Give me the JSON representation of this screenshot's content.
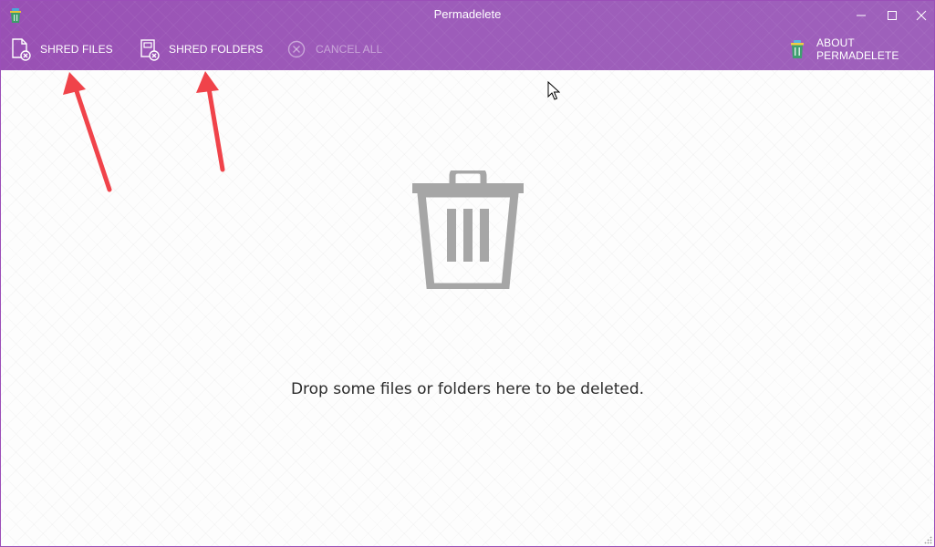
{
  "window": {
    "title": "Permadelete"
  },
  "toolbar": {
    "shred_files_label": "SHRED FILES",
    "shred_folders_label": "SHRED FOLDERS",
    "cancel_all_label": "CANCEL ALL",
    "about_label": "ABOUT PERMADELETE"
  },
  "main": {
    "drop_message": "Drop some files or folders here to be deleted."
  },
  "icons": {
    "app": "trash-can-icon",
    "shred_files": "file-delete-icon",
    "shred_folders": "folder-delete-icon",
    "cancel_all": "circle-x-icon",
    "about": "trash-can-icon",
    "drop_area": "trash-can-icon"
  },
  "colors": {
    "header": "#9a55b6",
    "window_border": "#9b4fb8",
    "trash_icon": "#a6a6a6",
    "annotation_arrow": "#f0434a"
  }
}
